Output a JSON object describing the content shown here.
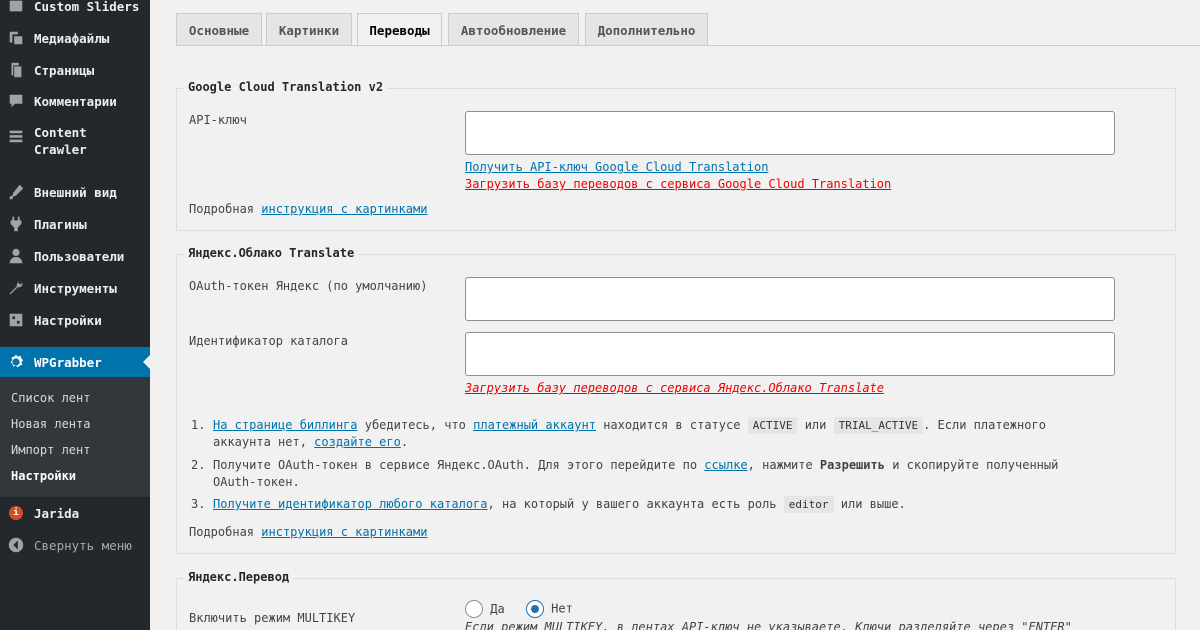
{
  "sidebar": {
    "items": [
      {
        "label": "Custom Sliders",
        "icon": "slides-icon"
      },
      {
        "label": "Медиафайлы",
        "icon": "media-icon"
      },
      {
        "label": "Страницы",
        "icon": "pages-icon"
      },
      {
        "label": "Комментарии",
        "icon": "comments-icon"
      },
      {
        "label": "Content Crawler",
        "icon": "crawler-icon"
      },
      {
        "label": "Внешний вид",
        "icon": "appearance-icon"
      },
      {
        "label": "Плагины",
        "icon": "plugins-icon"
      },
      {
        "label": "Пользователи",
        "icon": "users-icon"
      },
      {
        "label": "Инструменты",
        "icon": "tools-icon"
      },
      {
        "label": "Настройки",
        "icon": "settings-icon"
      },
      {
        "label": "WPGrabber",
        "icon": "gear-icon"
      },
      {
        "label": "Jarida",
        "icon": "jarida-icon"
      },
      {
        "label": "Свернуть меню",
        "icon": "collapse-icon"
      }
    ],
    "submenu": [
      "Список лент",
      "Новая лента",
      "Импорт лент",
      "Настройки"
    ],
    "content_crawler_line1": "Content",
    "content_crawler_line2": "Crawler",
    "accent_color": "#0073aa"
  },
  "tabs": [
    "Основные",
    "Картинки",
    "Переводы",
    "Автообновление",
    "Дополнительно"
  ],
  "active_tab": "Переводы",
  "google": {
    "legend": "Google Cloud Translation v2",
    "api_label": "API-ключ",
    "api_value": "",
    "get_key_link": "Получить API-ключ Google Cloud Translation",
    "load_db_link": "Загрузить базу переводов с сервиса Google Cloud Translation",
    "detail_prefix": "Подробная",
    "detail_link": "инструкция с картинками"
  },
  "yandex_cloud": {
    "legend": "Яндекс.Облако Translate",
    "oauth_label": "OAuth-токен Яндекс (по умолчанию)",
    "oauth_value": "",
    "catalog_label": "Идентификатор каталога",
    "catalog_value": "",
    "load_db_link": "Загрузить базу переводов с сервиса Яндекс.Облако Translate",
    "steps": {
      "s1_link1": "На странице биллинга",
      "s1_text1": "убедитесь, что",
      "s1_link2": "платежный аккаунт",
      "s1_text2": "находится в статусе",
      "s1_code1": "ACTIVE",
      "s1_or": "или",
      "s1_code2": "TRIAL_ACTIVE",
      "s1_text3": ". Если платежного",
      "s1_text4": "аккаунта нет,",
      "s1_link3": "создайте его",
      "s1_dot": ".",
      "s2_text1": "Получите OAuth-токен в сервисе Яндекс.OAuth. Для этого перейдите по",
      "s2_link": "ссылке",
      "s2_text2": ", нажмите",
      "s2_bold": "Разрешить",
      "s2_text3": "и скопируйте полученный",
      "s2_text4": "OAuth-токен.",
      "s3_link": "Получите идентификатор любого каталога",
      "s3_text1": ", на который у вашего аккаунта есть роль",
      "s3_code": "editor",
      "s3_text2": "или выше."
    },
    "detail_prefix": "Подробная",
    "detail_link": "инструкция с картинками"
  },
  "yandex_perevod": {
    "legend": "Яндекс.Перевод",
    "multikey_label": "Включить режим MULTIKEY",
    "option_yes": "Да",
    "option_no": "Нет",
    "selected": "Нет",
    "hint": "Если режим MULTIKEY, в лентах API-ключ не указываете. Ключи разделяйте через \"ENTER\""
  }
}
